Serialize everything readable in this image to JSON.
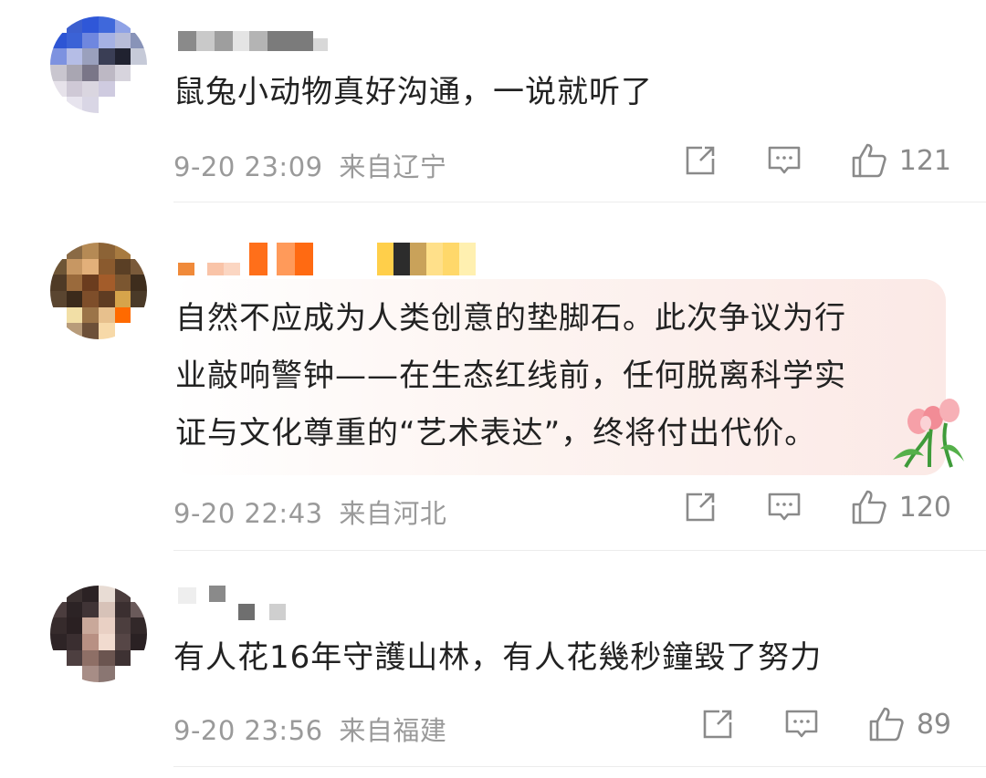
{
  "comments": [
    {
      "text": "鼠兔小动物真好沟通，一说就听了",
      "time": "9-20 23:09",
      "location": "来自辽宁",
      "likes": "121"
    },
    {
      "text": "自然不应成为人类创意的垫脚石。此次争议为行\n业敲响警钟——在生态红线前，任何脱离科学实\n证与文化尊重的“艺术表达”，终将付出代价。",
      "time": "9-20 22:43",
      "location": "来自河北",
      "likes": "120"
    },
    {
      "text": "有人花16年守護山林，有人花幾秒鐘毀了努力",
      "time": "9-20 23:56",
      "location": "来自福建",
      "likes": "89"
    }
  ],
  "icons": {
    "share": "share-icon",
    "reply": "comment-icon",
    "like": "thumbs-up-icon",
    "sticker": "tulip-icon"
  },
  "colors": {
    "text": "#222222",
    "meta": "#9a9a9a",
    "card_pink": "#fbe9e6"
  }
}
